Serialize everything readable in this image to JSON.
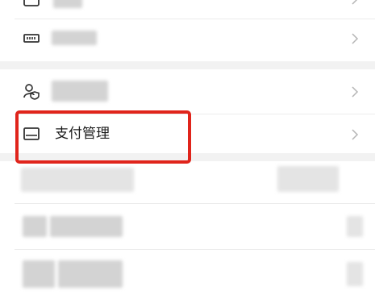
{
  "menu": {
    "payment_item": {
      "label": "支付管理",
      "icon": "card-icon"
    },
    "icons": [
      "wallet-icon",
      "shop-icon",
      "user-shield-icon",
      "card-icon"
    ]
  },
  "annotation": {
    "highlight_color": "#e0241b"
  }
}
